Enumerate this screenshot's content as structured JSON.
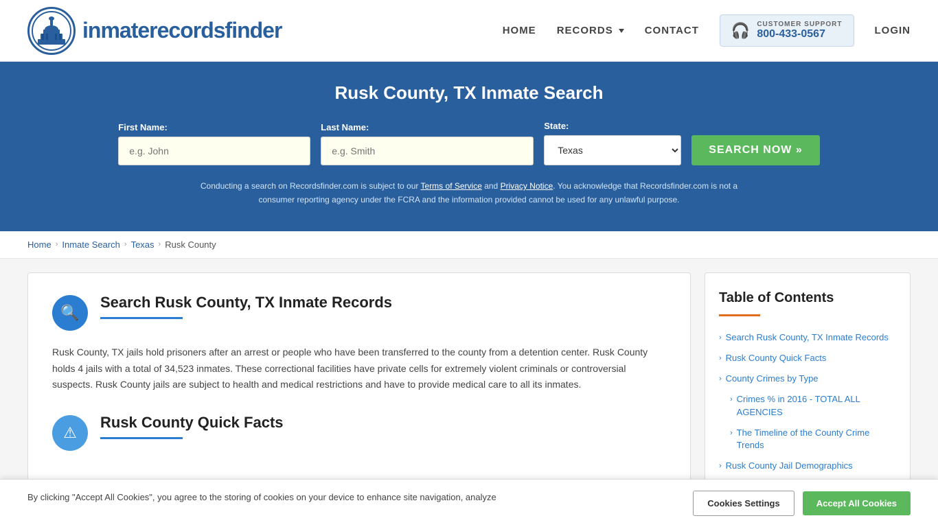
{
  "header": {
    "logo_text_part1": "inmaterecords",
    "logo_text_part2": "finder",
    "nav": {
      "home": "HOME",
      "records": "RECORDS",
      "contact": "CONTACT",
      "login": "LOGIN"
    },
    "support": {
      "label": "CUSTOMER SUPPORT",
      "phone": "800-433-0567"
    }
  },
  "hero": {
    "title": "Rusk County, TX Inmate Search",
    "first_name_label": "First Name:",
    "first_name_placeholder": "e.g. John",
    "last_name_label": "Last Name:",
    "last_name_placeholder": "e.g. Smith",
    "state_label": "State:",
    "state_value": "Texas",
    "search_button": "SEARCH NOW »",
    "disclaimer": "Conducting a search on Recordsfinder.com is subject to our Terms of Service and Privacy Notice. You acknowledge that Recordsfinder.com is not a consumer reporting agency under the FCRA and the information provided cannot be used for any unlawful purpose.",
    "terms_link": "Terms of Service",
    "privacy_link": "Privacy Notice"
  },
  "breadcrumb": {
    "home": "Home",
    "inmate_search": "Inmate Search",
    "state": "Texas",
    "county": "Rusk County"
  },
  "main_section": {
    "title": "Search Rusk County, TX Inmate Records",
    "body": "Rusk County, TX jails hold prisoners after an arrest or people who have been transferred to the county from a detention center. Rusk County holds 4 jails with a total of 34,523 inmates. These correctional facilities have private cells for extremely violent criminals or controversial suspects. Rusk County jails are subject to health and medical restrictions and have to provide medical care to all its inmates."
  },
  "quick_facts": {
    "title": "Rusk County Quick Facts"
  },
  "toc": {
    "title": "Table of Contents",
    "items": [
      {
        "label": "Search Rusk County, TX Inmate Records",
        "indented": false
      },
      {
        "label": "Rusk County Quick Facts",
        "indented": false
      },
      {
        "label": "County Crimes by Type",
        "indented": false
      },
      {
        "label": "Crimes % in 2016 - TOTAL ALL AGENCIES",
        "indented": true
      },
      {
        "label": "The Timeline of the County Crime Trends",
        "indented": true
      },
      {
        "label": "Rusk County Jail Demographics",
        "indented": false
      }
    ]
  },
  "cookie_banner": {
    "text": "By clicking \"Accept All Cookies\", you agree to the storing of cookies on your device to enhance site navigation, analyze",
    "settings_btn": "Cookies Settings",
    "accept_btn": "Accept All Cookies"
  }
}
